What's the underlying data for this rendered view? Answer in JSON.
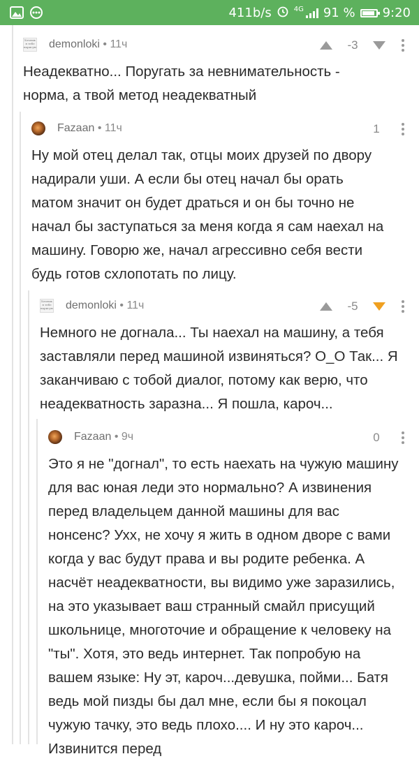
{
  "status_bar": {
    "speed": "411b/s",
    "network": "4G",
    "battery": "91 %",
    "battery_level": 0.91,
    "time": "9:20"
  },
  "comments": [
    {
      "author": "demonloki",
      "time": "11ч",
      "rating": "-3",
      "avatar": "sketch-avatar",
      "text": "Неадекватно... Поругать за невнимательность - норма, а твой метод неадекватный"
    },
    {
      "author": "Fazaan",
      "time": "11ч",
      "rating": "1",
      "avatar": "photo-avatar",
      "text": "Ну мой отец делал так, отцы моих друзей по двору надирали уши. А если бы отец начал бы орать матом значит он будет драться и он бы точно не начал бы заступаться за меня когда я сам наехал на машину. Говорю же, начал агрессивно себя вести будь готов схлопотать по лицу."
    },
    {
      "author": "demonloki",
      "time": "11ч",
      "rating": "-5",
      "avatar": "sketch-avatar",
      "downvote_active_color": "#f0a020",
      "text": "Немного не догнала... Ты наехал на машину, а тебя заставляли перед машиной извиняться? О_О Так... Я заканчиваю с тобой диалог, потому как верю, что неадекватность заразна... Я пошла, кароч..."
    },
    {
      "author": "Fazaan",
      "time": "9ч",
      "rating": "0",
      "avatar": "photo-avatar",
      "text": "Это я не \"догнал\", то есть наехать на чужую машину для вас юная леди это нормально? А извинения перед владельцем данной машины для вас нонсенс? Ухх, не хочу я жить в одном дворе с вами когда у вас будут права и вы родите ребенка. А насчёт неадекватности, вы видимо уже заразились, на это указывает ваш странный смайл присущий школьнице, многоточие и обращение к человеку на \"ты\". Хотя, это ведь интернет. Так попробую на вашем языке: Ну эт, кароч...девушка, пойми... Батя ведь мой пизды бы дал мне, если бы я покоцал чужую тачку, это ведь плохо.... И ну это кароч... Извинится перед"
    }
  ],
  "avatar_sketch_text": "Хочешь я тебе нарисую",
  "colors": {
    "status_bar": "#5db15d",
    "thread_line": "#e3e3e3",
    "meta_text": "#8a8a8a",
    "vote_icon": "#9a9a9a",
    "downvote_active": "#f0a020"
  }
}
